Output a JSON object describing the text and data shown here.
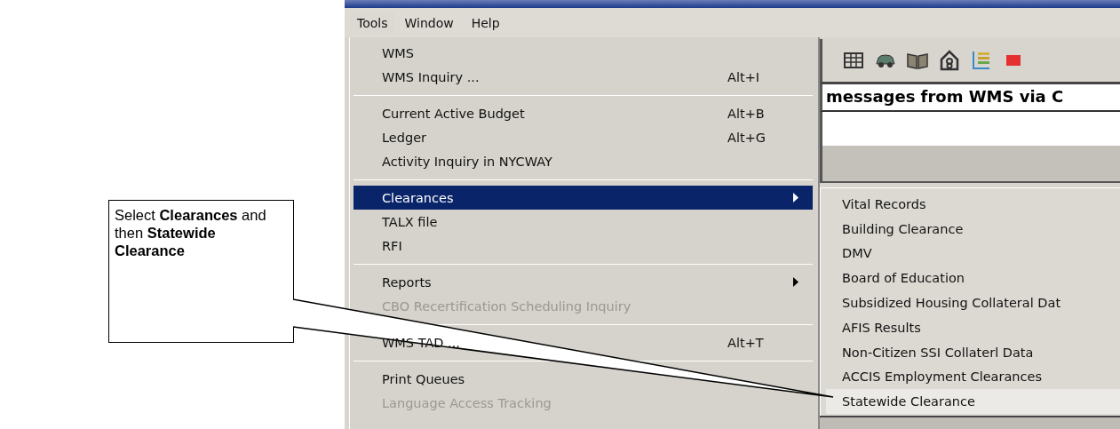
{
  "menubar": [
    {
      "label": "Tools",
      "selected": true
    },
    {
      "label": "Window",
      "selected": false
    },
    {
      "label": "Help",
      "selected": false
    }
  ],
  "menu": [
    {
      "kind": "item",
      "label": "WMS",
      "selected": false,
      "disabled": false
    },
    {
      "kind": "item",
      "label": "WMS Inquiry ...",
      "shortcut": "Alt+I",
      "selected": false,
      "disabled": false
    },
    {
      "kind": "separator"
    },
    {
      "kind": "item",
      "label": "Current Active Budget",
      "shortcut": "Alt+B",
      "selected": false,
      "disabled": false
    },
    {
      "kind": "item",
      "label": "Ledger",
      "shortcut": "Alt+G",
      "selected": false,
      "disabled": false
    },
    {
      "kind": "item",
      "label": "Activity Inquiry in NYCWAY",
      "selected": false,
      "disabled": false
    },
    {
      "kind": "separator"
    },
    {
      "kind": "item",
      "label": "Clearances",
      "selected": true,
      "disabled": false,
      "has_submenu": true
    },
    {
      "kind": "item",
      "label": "TALX file",
      "selected": false,
      "disabled": false
    },
    {
      "kind": "item",
      "label": "RFI",
      "selected": false,
      "disabled": false
    },
    {
      "kind": "separator"
    },
    {
      "kind": "item",
      "label": "Reports",
      "selected": false,
      "disabled": false,
      "has_submenu": true
    },
    {
      "kind": "item",
      "label": "CBO Recertification Scheduling Inquiry",
      "selected": false,
      "disabled": true
    },
    {
      "kind": "separator"
    },
    {
      "kind": "item",
      "label": "WMS TAD ...",
      "shortcut": "Alt+T",
      "selected": false,
      "disabled": false
    },
    {
      "kind": "separator"
    },
    {
      "kind": "item",
      "label": "Print Queues",
      "selected": false,
      "disabled": false
    },
    {
      "kind": "item",
      "label": "Language Access Tracking",
      "selected": false,
      "disabled": true
    }
  ],
  "message": "messages from WMS via C",
  "submenu": [
    {
      "label": "Vital Records",
      "selected": false
    },
    {
      "label": "Building Clearance",
      "selected": false
    },
    {
      "label": "DMV",
      "selected": false
    },
    {
      "label": "Board of Education",
      "selected": false
    },
    {
      "label": "Subsidized Housing Collateral Dat",
      "selected": false
    },
    {
      "label": "AFIS Results",
      "selected": false
    },
    {
      "label": "Non-Citizen SSI Collaterl Data",
      "selected": false
    },
    {
      "label": "ACCIS Employment Clearances",
      "selected": false
    },
    {
      "label": "Statewide Clearance",
      "selected": true
    }
  ],
  "callout": "Select **Clearances** and then **Statewide Clearance**"
}
